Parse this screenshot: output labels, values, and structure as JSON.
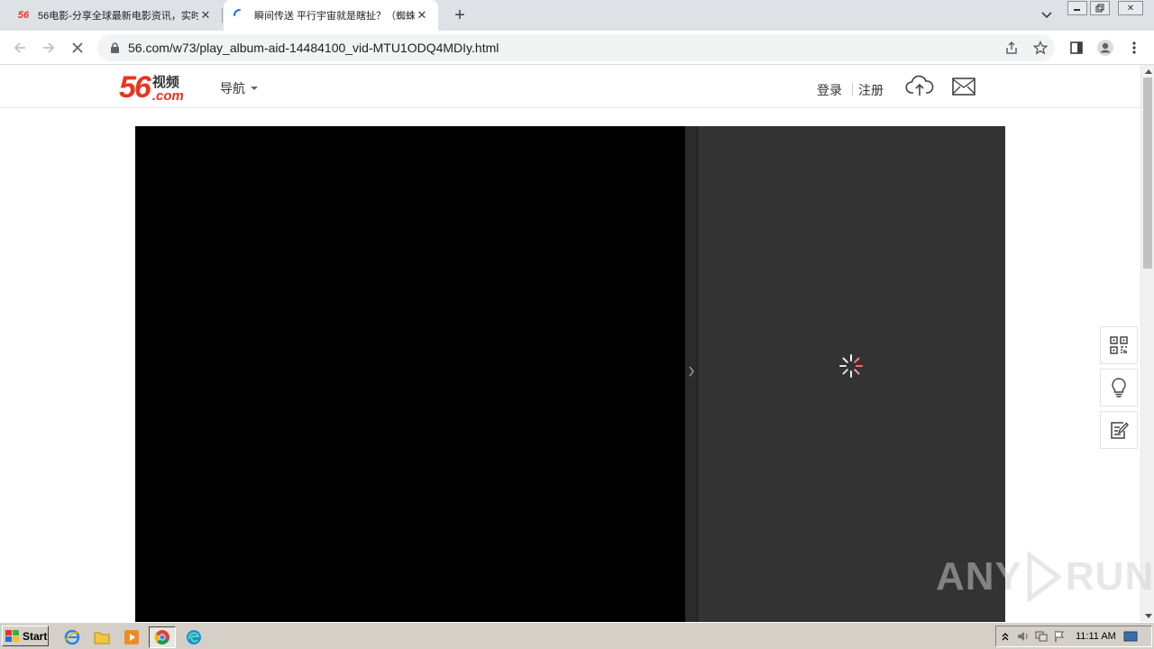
{
  "browser": {
    "tabs": [
      {
        "favicon": "56",
        "title": "56电影-分享全球最新电影资讯，实时",
        "active": false
      },
      {
        "favicon": "loading-spinner-icon",
        "title": "瞬间传送 平行宇宙就是瞎扯？（蜘蛛",
        "active": true
      }
    ],
    "url": "56.com/w73/play_album-aid-14484100_vid-MTU1ODQ4MDIy.html"
  },
  "site": {
    "logo_number": "56",
    "logo_cn": "视频",
    "logo_com": ".com",
    "nav_label": "导航",
    "login_label": "登录",
    "register_label": "注册"
  },
  "watermark": {
    "left": "ANY",
    "right": "RUN"
  },
  "taskbar": {
    "start_label": "Start",
    "clock": "11:11 AM"
  },
  "colors": {
    "brand_red": "#e8351f",
    "player_bg": "#000000",
    "side_panel_bg": "#333333"
  }
}
